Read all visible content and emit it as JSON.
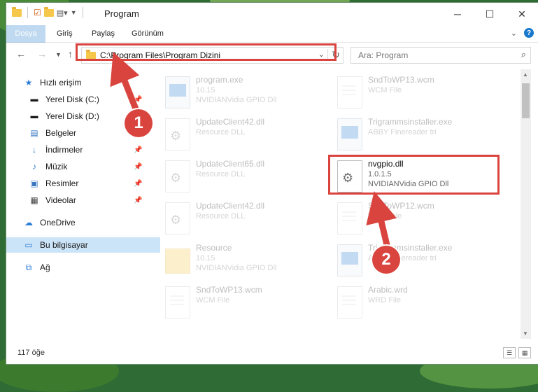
{
  "window": {
    "title": "Program"
  },
  "ribbon": {
    "tabs": [
      "Dosya",
      "Giriş",
      "Paylaş",
      "Görünüm"
    ]
  },
  "address": {
    "path": "C:\\Program Files\\Program Dizini"
  },
  "search": {
    "placeholder": "Ara: Program"
  },
  "sidebar": {
    "items": [
      {
        "label": "Hızlı erişim",
        "icon": "star-icon"
      },
      {
        "label": "Yerel Disk (C:)",
        "icon": "drive-icon"
      },
      {
        "label": "Yerel Disk (D:)",
        "icon": "drive-icon"
      },
      {
        "label": "Belgeler",
        "icon": "documents-icon"
      },
      {
        "label": "İndirmeler",
        "icon": "download-icon"
      },
      {
        "label": "Müzik",
        "icon": "music-icon"
      },
      {
        "label": "Resimler",
        "icon": "pictures-icon"
      },
      {
        "label": "Videolar",
        "icon": "video-icon"
      },
      {
        "label": "OneDrive",
        "icon": "cloud-icon"
      },
      {
        "label": "Bu bilgisayar",
        "icon": "computer-icon"
      },
      {
        "label": "Ağ",
        "icon": "network-icon"
      }
    ]
  },
  "files": [
    {
      "name": "program.exe",
      "l2": "10.15",
      "l3": "NVIDIANVidia GPIO Dll"
    },
    {
      "name": "SndToWP13.wcm",
      "l2": "WCM File",
      "l3": ""
    },
    {
      "name": "UpdateClient42.dll",
      "l2": "Resource DLL",
      "l3": ""
    },
    {
      "name": "Trigrammsinstaller.exe",
      "l2": "ABBY Finereader tri",
      "l3": ""
    },
    {
      "name": "UpdateClient65.dll",
      "l2": "Resource DLL",
      "l3": ""
    },
    {
      "name": "nvgpio.dll",
      "l2": "1.0.1.5",
      "l3": "NVIDIANVidia GPIO Dll"
    },
    {
      "name": "UpdateClient42.dll",
      "l2": "Resource DLL",
      "l3": ""
    },
    {
      "name": "SndToWP12.wcm",
      "l2": "WCM File",
      "l3": ""
    },
    {
      "name": "Resource",
      "l2": "10.15",
      "l3": "NVIDIANVidia GPIO Dll"
    },
    {
      "name": "Trigrammsinstaller.exe",
      "l2": "ABBY Finereader tri",
      "l3": ""
    },
    {
      "name": "SndToWP13.wcm",
      "l2": "WCM File",
      "l3": ""
    },
    {
      "name": "Arabic.wrd",
      "l2": "WRD File",
      "l3": ""
    }
  ],
  "status": {
    "count": "117 öğe"
  },
  "callouts": [
    "1",
    "2"
  ],
  "colors": {
    "accent": "#1979ca",
    "highlight": "#d9443e"
  }
}
